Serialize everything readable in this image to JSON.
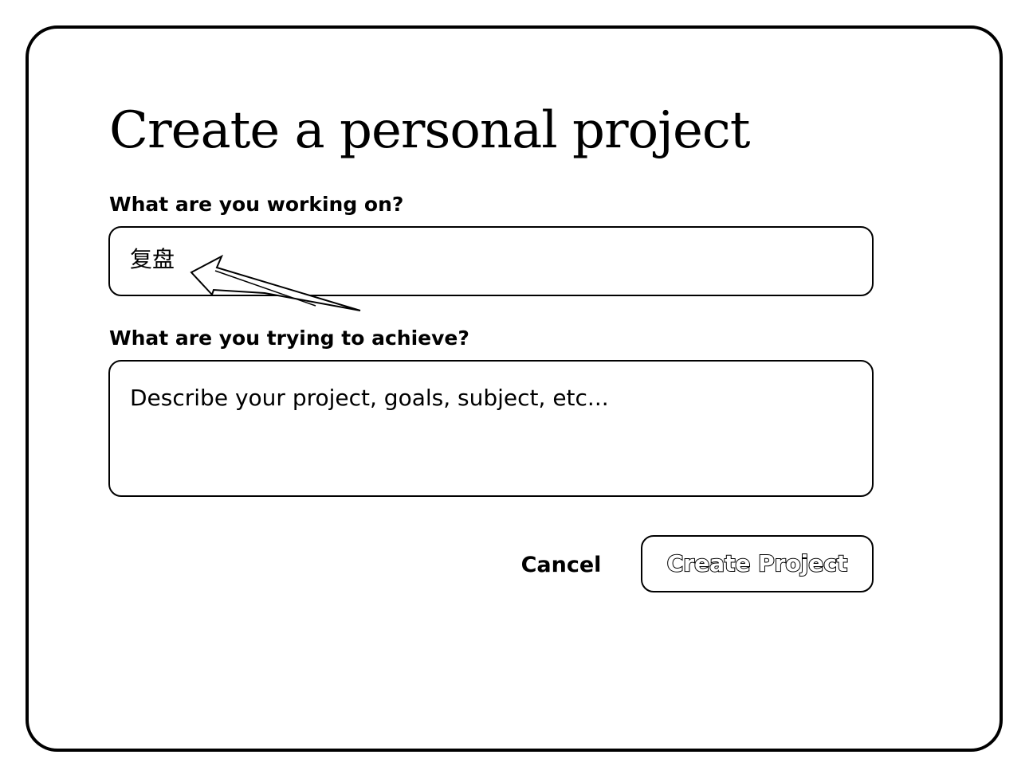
{
  "dialog": {
    "title": "Create a personal project",
    "name_field": {
      "label": "What are you working on?",
      "value": "复盘"
    },
    "goal_field": {
      "label": "What are you trying to achieve?",
      "placeholder": "Describe your project, goals, subject, etc..."
    },
    "actions": {
      "cancel_label": "Cancel",
      "create_label": "Create Project"
    }
  },
  "annotation": {
    "icon": "arrow-icon",
    "color": "#000000"
  }
}
